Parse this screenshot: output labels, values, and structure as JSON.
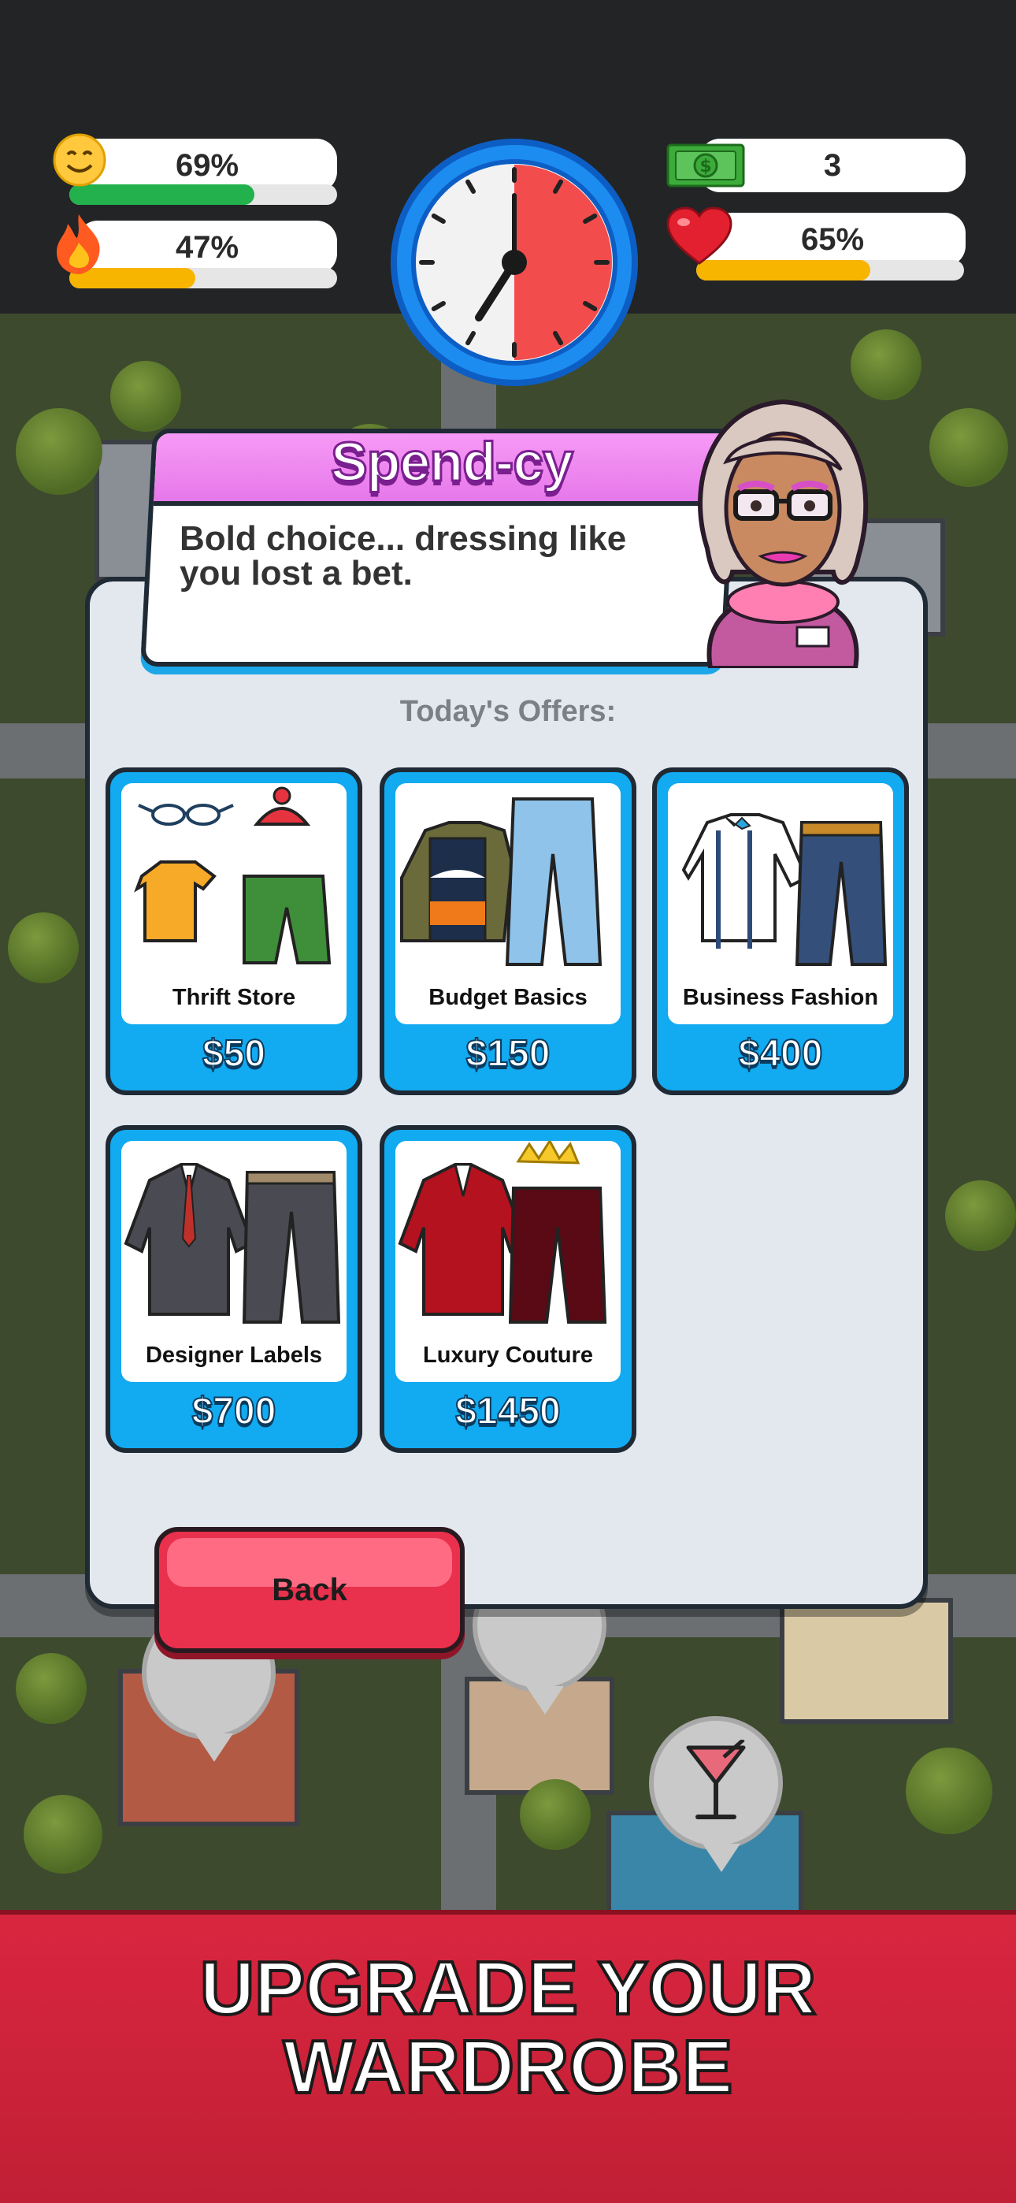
{
  "hud": {
    "happiness": {
      "value_label": "69%",
      "fraction": 0.69,
      "bar_color": "#22b14c",
      "icon": "smiley-face-icon"
    },
    "energy": {
      "value_label": "47%",
      "fraction": 0.47,
      "bar_color": "#f7b500",
      "icon": "flame-icon"
    },
    "money": {
      "value_label": "3",
      "icon": "cash-bill-icon"
    },
    "health": {
      "value_label": "65%",
      "fraction": 0.65,
      "bar_color": "#f7b500",
      "icon": "heart-icon"
    },
    "clock": {
      "elapsed_fraction": 0.5,
      "icon": "clock-icon"
    }
  },
  "dialog": {
    "speaker": "Spend-cy",
    "message": "Bold choice... dressing like you lost a bet.",
    "offers_title": "Today's Offers:",
    "offers": [
      {
        "name": "Thrift Store",
        "price": "$50",
        "art": "thrift-store-clothes-icon"
      },
      {
        "name": "Budget Basics",
        "price": "$150",
        "art": "budget-basics-clothes-icon"
      },
      {
        "name": "Business Fashion",
        "price": "$400",
        "art": "business-fashion-clothes-icon"
      },
      {
        "name": "Designer Labels",
        "price": "$700",
        "art": "designer-labels-suit-icon"
      },
      {
        "name": "Luxury Couture",
        "price": "$1450",
        "art": "luxury-couture-suit-icon"
      }
    ],
    "back_label": "Back"
  },
  "banner": {
    "line1": "UPGRADE YOUR",
    "line2": "WARDROBE"
  },
  "colors": {
    "accent_blue": "#12aaf0",
    "back_red": "#e9304d",
    "banner_red": "#d9263f",
    "speech_pink": "#f79af6"
  }
}
